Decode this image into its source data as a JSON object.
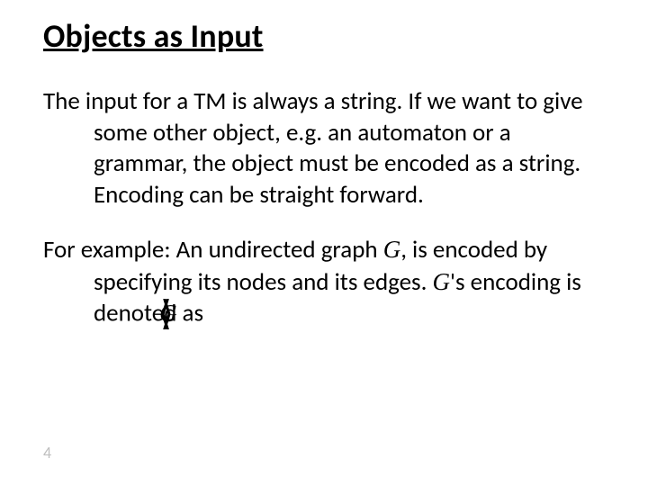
{
  "title": "Objects as Input",
  "para1": {
    "text": "The input for a TM is always a string. If we want to give some other object, e.g. an automaton or a grammar, the object must be encoded as a string. Encoding can be straight forward."
  },
  "para2": {
    "lead": "For example: An undirected graph ",
    "G1": "G",
    "mid1": ", is encoded by specifying its nodes and its edges. ",
    "G2": "G",
    "mid2": "'s encoding is denoted as ",
    "enc_sym": "G"
  },
  "page_number": "4"
}
